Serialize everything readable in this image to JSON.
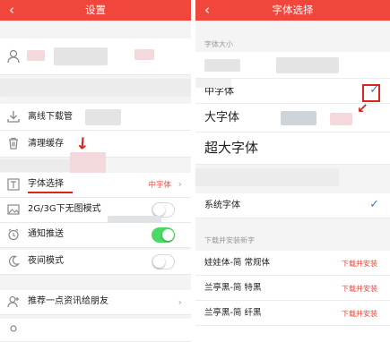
{
  "settings": {
    "title": "设置",
    "items": [
      {
        "label": "离线下载管",
        "icon": "download-icon"
      },
      {
        "label": "清理缓存",
        "icon": "trash-icon"
      },
      {
        "label": "字体选择",
        "icon": "font-icon",
        "value": "中字体"
      },
      {
        "label": "2G/3G下无图模式",
        "icon": "image-icon",
        "toggle": false
      },
      {
        "label": "通知推送",
        "icon": "alarm-clock-icon",
        "toggle": true
      },
      {
        "label": "夜间模式",
        "icon": "moon-icon",
        "toggle": false
      },
      {
        "label": "推荐一点资讯给朋友",
        "icon": "user-add-icon"
      }
    ]
  },
  "font_select": {
    "title": "字体选择",
    "size_section": "字体大小",
    "sizes": [
      "中字体",
      "大字体",
      "超大字体"
    ],
    "selected_size": "中字体",
    "system_font": "系统字体",
    "system_selected": true,
    "download_section": "下载并安装新字",
    "downloads": [
      {
        "name": "娃娃体-简 常规体",
        "action": "下载并安装"
      },
      {
        "name": "兰亭黑-简 特黑",
        "action": "下载并安装"
      },
      {
        "name": "兰亭黑-简 纤黑",
        "action": "下载并安装"
      }
    ]
  },
  "colors": {
    "accent": "#f0463c",
    "check": "#3a7bd5",
    "annotation": "#d9251c",
    "toggle_on": "#4cd964"
  }
}
